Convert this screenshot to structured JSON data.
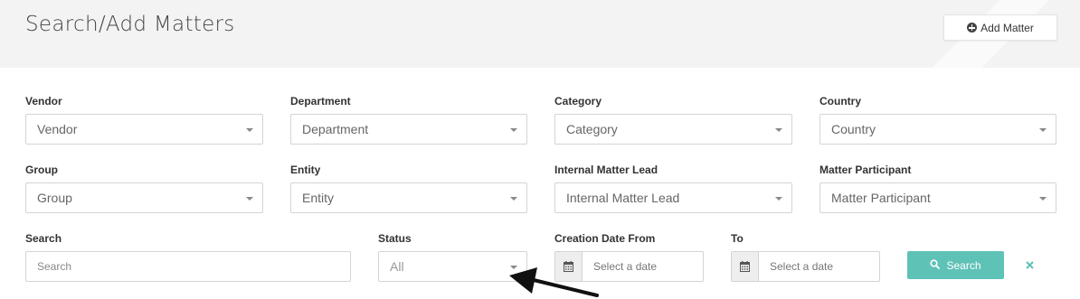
{
  "header": {
    "title": "Search/Add Matters",
    "add_button_label": "Add Matter"
  },
  "filters": {
    "row1": [
      {
        "label": "Vendor",
        "value": "Vendor"
      },
      {
        "label": "Department",
        "value": "Department"
      },
      {
        "label": "Category",
        "value": "Category"
      },
      {
        "label": "Country",
        "value": "Country"
      }
    ],
    "row2": [
      {
        "label": "Group",
        "value": "Group"
      },
      {
        "label": "Entity",
        "value": "Entity"
      },
      {
        "label": "Internal Matter Lead",
        "value": "Internal Matter Lead"
      },
      {
        "label": "Matter Participant",
        "value": "Matter Participant"
      }
    ]
  },
  "search": {
    "label": "Search",
    "placeholder": "Search"
  },
  "status": {
    "label": "Status",
    "value": "All"
  },
  "creation_date": {
    "from_label": "Creation Date From",
    "to_label": "To",
    "from_placeholder": "Select a date",
    "to_placeholder": "Select a date"
  },
  "actions": {
    "search_label": "Search"
  },
  "colors": {
    "accent": "#5fc2b7",
    "header_bg": "#f3f3f4"
  },
  "icons": [
    "plus-circle-icon",
    "chevron-down-icon",
    "calendar-icon",
    "search-icon",
    "close-icon",
    "arrow-pointer"
  ]
}
